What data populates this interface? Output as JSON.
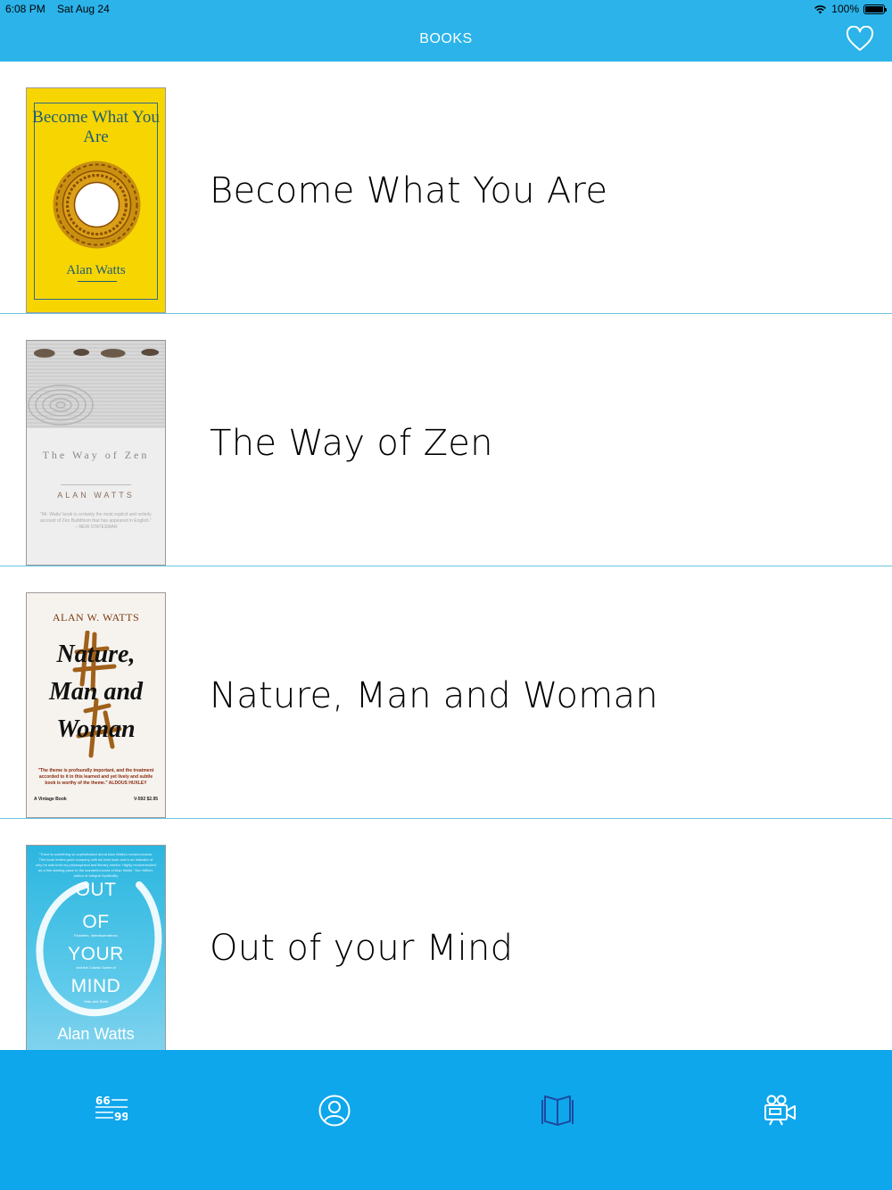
{
  "status_bar": {
    "time": "6:08 PM",
    "date": "Sat Aug 24",
    "battery": "100%"
  },
  "nav": {
    "title": "BOOKS",
    "favorite_icon": "heart-icon"
  },
  "books": [
    {
      "title": "Become What You Are",
      "cover": {
        "title": "Become What You Are",
        "author": "Alan Watts",
        "bg": "#f7d500"
      }
    },
    {
      "title": "The Way of Zen",
      "cover": {
        "title": "The Way of Zen",
        "author": "ALAN WATTS",
        "quote": "\"Mr. Watts' book is certainly the most explicit and orderly account of Zen Buddhism that has appeared in English.\" —NEW STATESMAN"
      }
    },
    {
      "title": "Nature, Man and Woman",
      "cover": {
        "author": "ALAN W. WATTS",
        "title_line1": "Nature,",
        "title_line2": "Man and",
        "title_line3": "Woman",
        "quote": "\"The theme is profoundly important, and the treatment accorded to it in this learned and yet lively and subtle book is worthy of the theme.\" ALDOUS HUXLEY",
        "publisher": "A Vintage Book",
        "code": "V-592 $2.95"
      }
    },
    {
      "title": "Out of your Mind",
      "cover": {
        "quote": "\"There is something so sophisticated about Alan Watts's consciousness. This book invites good company with his best work and is an indicator of why he was both my philosophical and literary mentor. Highly recommended as a fine starting place to the wonderful world of Alan Watts.\" Ken Wilber, author of Integral Spirituality",
        "word1": "OUT",
        "word2": "OF",
        "word3": "YOUR",
        "word4": "MIND",
        "subtitle1": "Tricksters, Interdependence,",
        "subtitle2": "and the Cosmic Game of",
        "subtitle3": "Hide-and-Seek",
        "author": "Alan Watts"
      }
    }
  ],
  "tabs": [
    {
      "icon": "quotes-icon"
    },
    {
      "icon": "profile-icon"
    },
    {
      "icon": "book-icon",
      "selected": true
    },
    {
      "icon": "video-camera-icon"
    }
  ],
  "colors": {
    "nav_bg": "#2bb3ea",
    "tabbar_bg": "#0fa7ec",
    "tab_icon": "#ffffff",
    "tab_icon_selected": "#1a4ba0",
    "separator": "#6cc3de"
  }
}
